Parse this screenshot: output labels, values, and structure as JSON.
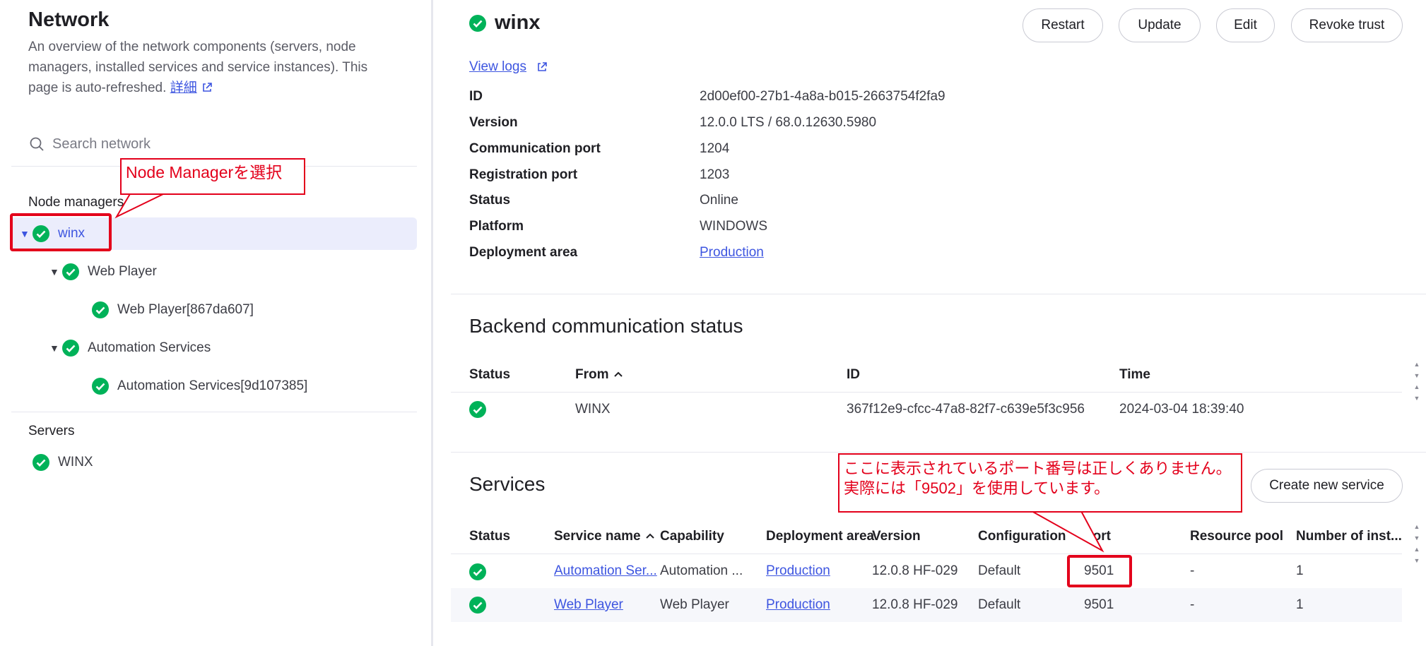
{
  "sidebar": {
    "title": "Network",
    "description": "An overview of the network components (servers, node managers, installed services and service instances). This page is auto-refreshed.",
    "more_link": "詳細",
    "search_placeholder": "Search network",
    "node_managers_label": "Node managers",
    "tree": [
      {
        "label": "winx",
        "selected": true
      },
      {
        "label": "Web Player"
      },
      {
        "label": "Web Player[867da607]"
      },
      {
        "label": "Automation Services"
      },
      {
        "label": "Automation Services[9d107385]"
      }
    ],
    "servers_label": "Servers",
    "servers": [
      {
        "label": "WINX"
      }
    ]
  },
  "header": {
    "title": "winx",
    "buttons": {
      "restart": "Restart",
      "update": "Update",
      "edit": "Edit",
      "revoke": "Revoke trust"
    },
    "view_logs": "View logs"
  },
  "details": [
    {
      "key": "ID",
      "value": "2d00ef00-27b1-4a8a-b015-2663754f2fa9"
    },
    {
      "key": "Version",
      "value": "12.0.0 LTS / 68.0.12630.5980"
    },
    {
      "key": "Communication port",
      "value": "1204"
    },
    {
      "key": "Registration port",
      "value": "1203"
    },
    {
      "key": "Status",
      "value": "Online"
    },
    {
      "key": "Platform",
      "value": "WINDOWS"
    },
    {
      "key": "Deployment area",
      "value": "Production"
    }
  ],
  "backend": {
    "title": "Backend communication status",
    "columns": {
      "status": "Status",
      "from": "From",
      "id": "ID",
      "time": "Time"
    },
    "rows": [
      {
        "from": "WINX",
        "id": "367f12e9-cfcc-47a8-82f7-c639e5f3c956",
        "time": "2024-03-04 18:39:40"
      }
    ]
  },
  "services": {
    "title": "Services",
    "create_button": "Create new service",
    "columns": {
      "status": "Status",
      "name": "Service name",
      "capability": "Capability",
      "area": "Deployment area",
      "version": "Version",
      "configuration": "Configuration",
      "port": "Port",
      "pool": "Resource pool",
      "instances": "Number of inst..."
    },
    "rows": [
      {
        "name": "Automation Ser...",
        "capability": "Automation ...",
        "area": "Production",
        "version": "12.0.8 HF-029",
        "configuration": "Default",
        "port": "9501",
        "pool": "-",
        "instances": "1"
      },
      {
        "name": "Web Player",
        "capability": "Web Player",
        "area": "Production",
        "version": "12.0.8 HF-029",
        "configuration": "Default",
        "port": "9501",
        "pool": "-",
        "instances": "1"
      }
    ]
  },
  "annotations": {
    "node_callout": "Node  Managerを選択",
    "port_callout_line1": "ここに表示されているポート番号は正しくありません。",
    "port_callout_line2": "実際には「9502」を使用しています。"
  },
  "colors": {
    "accent": "#3d55e0",
    "success": "#00b259",
    "annotation": "#e3001b"
  }
}
